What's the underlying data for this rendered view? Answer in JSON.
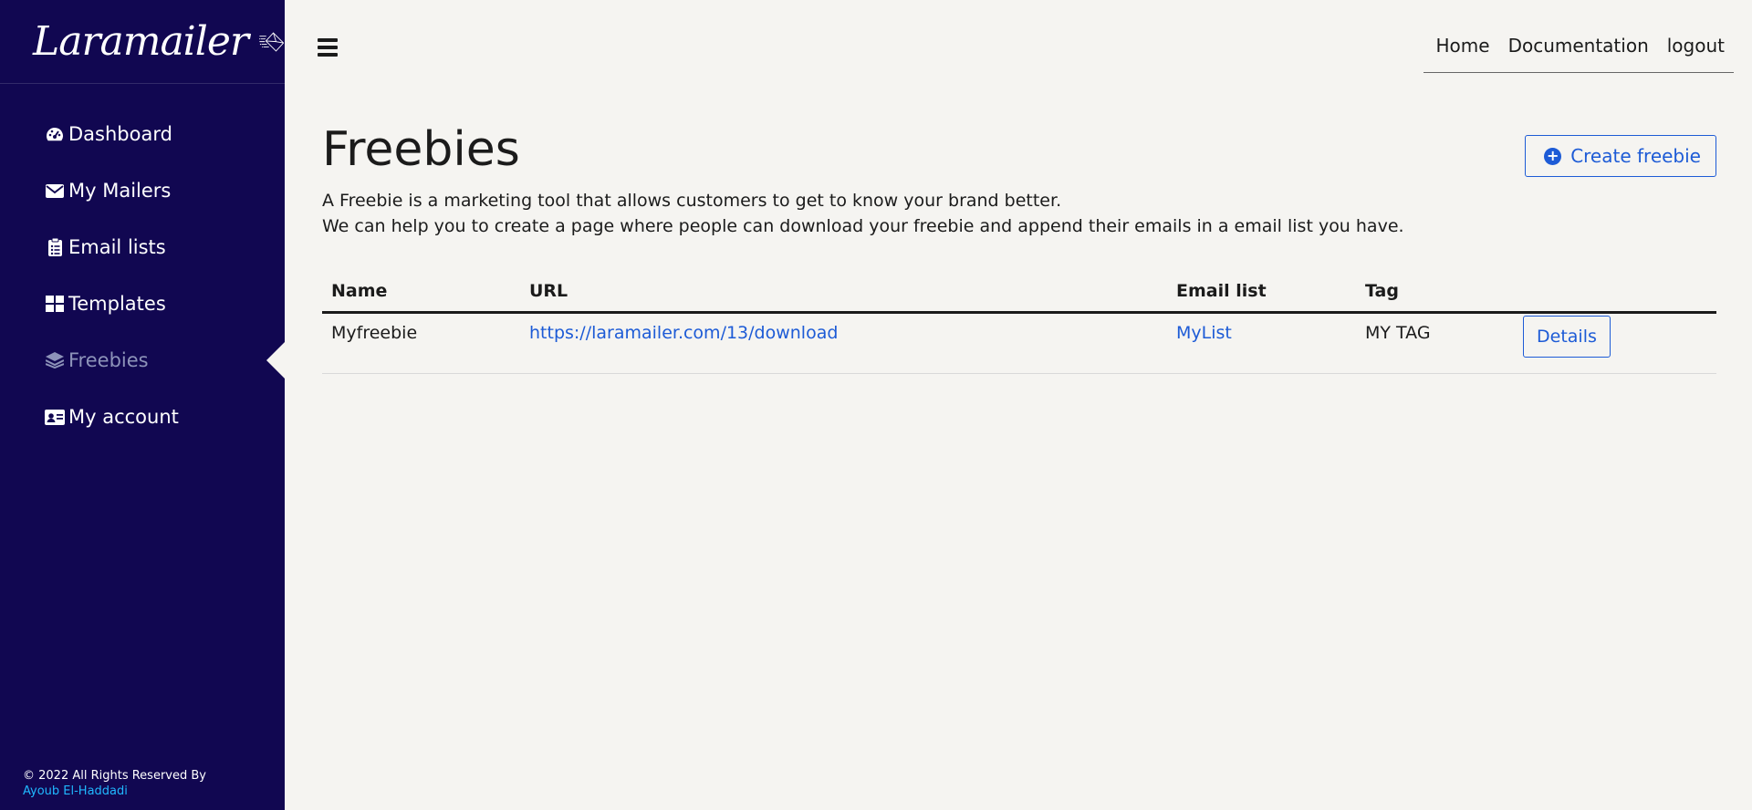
{
  "brand": {
    "name": "Laramailer"
  },
  "sidebar": {
    "items": [
      {
        "label": "Dashboard",
        "icon": "dashboard-icon",
        "active": false
      },
      {
        "label": "My Mailers",
        "icon": "envelope-icon",
        "active": false
      },
      {
        "label": "Email lists",
        "icon": "clipboard-list-icon",
        "active": false
      },
      {
        "label": "Templates",
        "icon": "grid-icon",
        "active": false
      },
      {
        "label": "Freebies",
        "icon": "layers-icon",
        "active": true
      },
      {
        "label": "My account",
        "icon": "id-card-icon",
        "active": false
      }
    ],
    "footer": {
      "copyright": "© 2022 All Rights Reserved By",
      "author": "Ayoub El-Haddadi"
    }
  },
  "topnav": {
    "links": [
      "Home",
      "Documentation",
      "logout"
    ]
  },
  "main": {
    "title": "Freebies",
    "create_label": "Create freebie",
    "description_line1": "A Freebie is a marketing tool that allows customers to get to know your brand better.",
    "description_line2": "We can help you to create a page where people can download your freebie and append their emails in a email list you have.",
    "table": {
      "headers": [
        "Name",
        "URL",
        "Email list",
        "Tag",
        ""
      ],
      "rows": [
        {
          "name": "Myfreebie",
          "url": "https://laramailer.com/13/download",
          "email_list": "MyList",
          "tag": "MY TAG",
          "action": "Details"
        }
      ]
    }
  },
  "colors": {
    "sidebar_bg": "#110751",
    "accent": "#1d5bd6",
    "page_bg": "#f5f4f1",
    "active_item": "#8d93b9",
    "author_link": "#20b8ff"
  }
}
